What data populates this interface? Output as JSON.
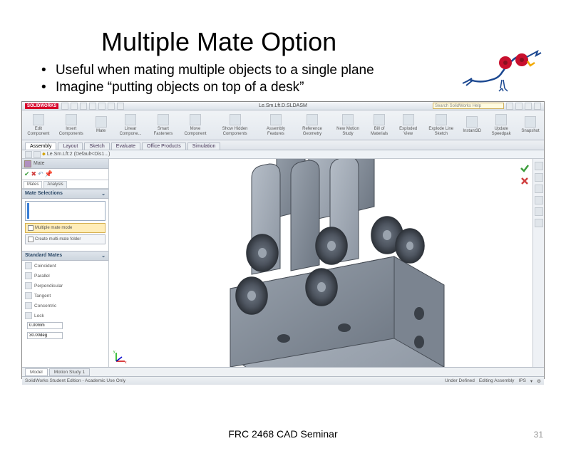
{
  "title": "Multiple Mate Option",
  "bullets": [
    "Useful when mating multiple objects to a single plane",
    "Imagine “putting objects on top of a desk”"
  ],
  "footer": "FRC 2468 CAD Seminar",
  "slide_number": "31",
  "app": {
    "logo": "SOLIDWORKS",
    "window_title": "Le.Sm.Lft.D.SLDASM",
    "search_placeholder": "Search SolidWorks Help"
  },
  "ribbon": [
    "Edit Component",
    "Insert Components",
    "Mate",
    "Linear Compone...",
    "Smart Fasteners",
    "Move Component",
    "Show Hidden Components",
    "Assembly Features",
    "Reference Geometry",
    "New Motion Study",
    "Bill of Materials",
    "Exploded View",
    "Explode Line Sketch",
    "Instant3D",
    "Update Speedpak",
    "Snapshot"
  ],
  "tabs": [
    "Assembly",
    "Layout",
    "Sketch",
    "Evaluate",
    "Office Products",
    "Simulation"
  ],
  "doc_header": "Le.Sm.Lft:2 (Default<Dis1...)",
  "panel": {
    "title": "Mate",
    "tabs": [
      "Mates",
      "Analysis"
    ],
    "section1": "Mate Selections",
    "multiple_mate": "Multiple mate mode",
    "create_folder": "Create multi-mate folder",
    "section2": "Standard Mates",
    "std": [
      "Coincident",
      "Parallel",
      "Perpendicular",
      "Tangent",
      "Concentric",
      "Lock"
    ],
    "dims": [
      "0.00mm",
      "30.00deg"
    ]
  },
  "bottom_tabs": [
    "Model",
    "Motion Study 1"
  ],
  "status": {
    "left": "SolidWorks Student Edition - Academic Use Only",
    "right1": "Under Defined",
    "right2": "Editing Assembly",
    "right3": "IPS"
  }
}
